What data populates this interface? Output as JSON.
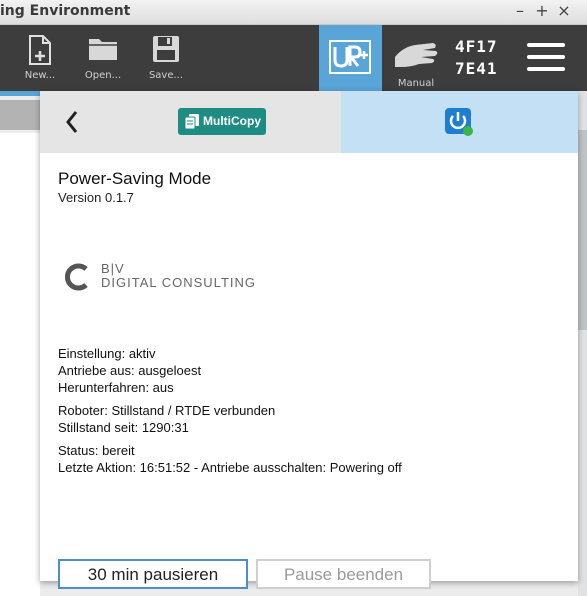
{
  "window": {
    "title": "ing Environment",
    "controls": {
      "minimize": "–",
      "maximize": "+",
      "close": "×"
    }
  },
  "toolbar": {
    "new_label": "New...",
    "open_label": "Open...",
    "save_label": "Save...",
    "mode_label": "Manual",
    "serial_line1": "4F17",
    "serial_line2": "7E41",
    "accent_color": "#5aa5d8"
  },
  "dialog": {
    "multicopy_label": "MultiCopy",
    "multicopy_color": "#1f8c84",
    "active_tab_color": "#c4e0f5"
  },
  "plugin": {
    "title": "Power-Saving Mode",
    "version": "Version 0.1.7",
    "logo_line1": "B|V",
    "logo_line2": "DIGITAL CONSULTING"
  },
  "status": {
    "setting": "Einstellung: aktiv",
    "drives_off": "Antriebe aus: ausgeloest",
    "shutdown": "Herunterfahren: aus",
    "robot": "Roboter: Stillstand / RTDE verbunden",
    "standstill_since": "Stillstand seit: 1290:31",
    "state": "Status: bereit",
    "last_action": "Letzte Aktion: 16:51:52 - Antriebe ausschalten: Powering off"
  },
  "buttons": {
    "pause_label": "30 min pausieren",
    "end_pause_label": "Pause beenden"
  }
}
